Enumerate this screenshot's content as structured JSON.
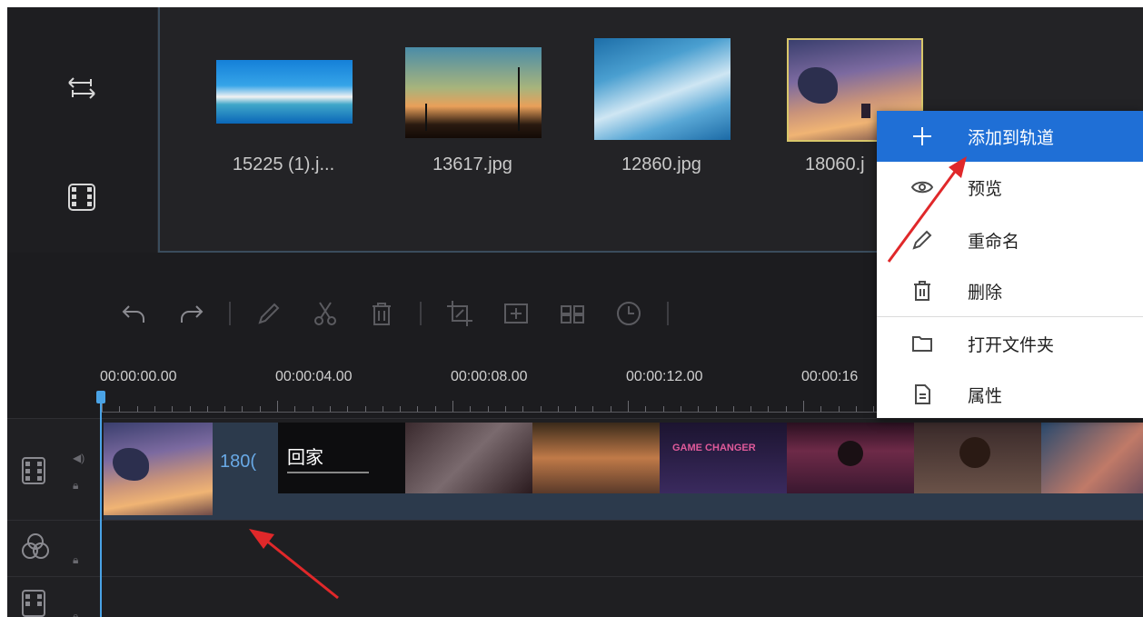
{
  "media_library": {
    "items": [
      {
        "name": "15225 (1).j..."
      },
      {
        "name": "13617.jpg"
      },
      {
        "name": "12860.jpg"
      },
      {
        "name": "18060.j"
      }
    ]
  },
  "timeline": {
    "time_marks": [
      "00:00:00.00",
      "00:00:04.00",
      "00:00:08.00",
      "00:00:12.00",
      "00:00:16"
    ],
    "clip_label": "180(",
    "title_clip_text": "回家",
    "game_clip_text": "GAME CHANGER"
  },
  "context_menu": {
    "items": [
      {
        "label": "添加到轨道",
        "icon": "plus-icon",
        "active": true
      },
      {
        "label": "预览",
        "icon": "eye-icon"
      },
      {
        "label": "重命名",
        "icon": "pencil-icon"
      },
      {
        "label": "删除",
        "icon": "trash-icon"
      },
      {
        "label": "打开文件夹",
        "icon": "folder-icon"
      },
      {
        "label": "属性",
        "icon": "properties-icon"
      }
    ]
  },
  "colors": {
    "menu_highlight": "#1f6fd6",
    "selection_border": "#d9c76a",
    "playhead": "#4aa3e6",
    "annotation_arrow": "#e0282a"
  }
}
